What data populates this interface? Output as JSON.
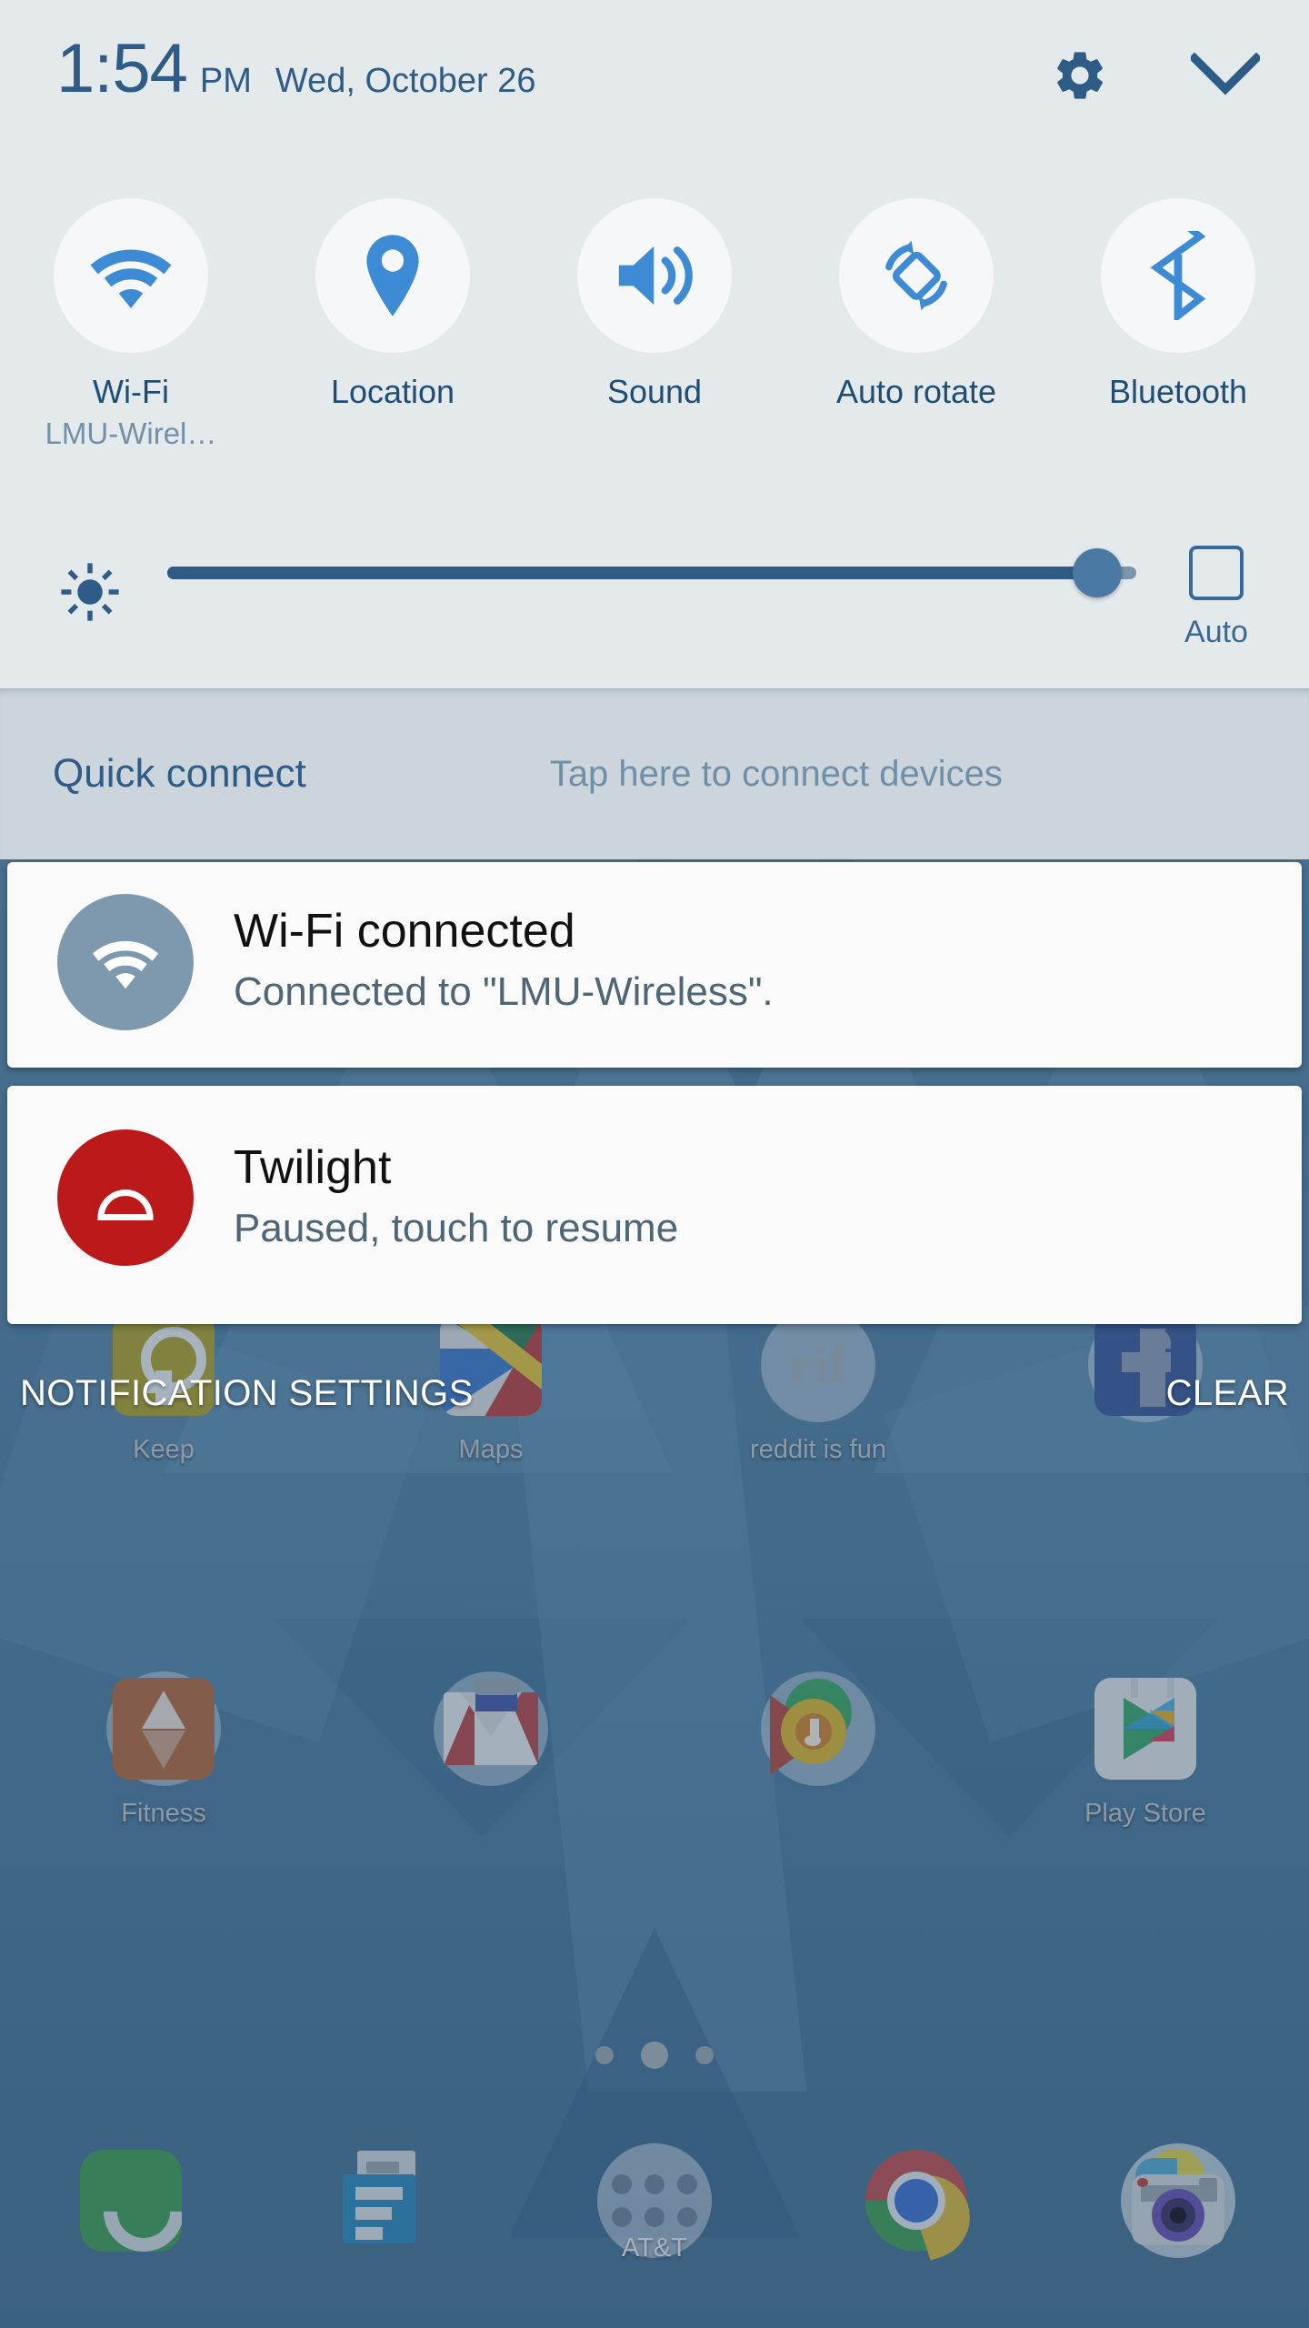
{
  "status_bar": {
    "time": "1:54",
    "am_pm": "PM",
    "date": "Wed, October 26",
    "settings_icon": "gear-icon",
    "collapse_icon": "chevron-down-icon"
  },
  "quick_toggles": [
    {
      "label": "Wi-Fi",
      "sub": "LMU-Wirel…",
      "icon": "wifi-icon",
      "active": true
    },
    {
      "label": "Location",
      "sub": "",
      "icon": "location-pin-icon",
      "active": true
    },
    {
      "label": "Sound",
      "sub": "",
      "icon": "sound-speaker-icon",
      "active": true
    },
    {
      "label": "Auto rotate",
      "sub": "",
      "icon": "auto-rotate-icon",
      "active": true
    },
    {
      "label": "Bluetooth",
      "sub": "",
      "icon": "bluetooth-icon",
      "active": true
    }
  ],
  "brightness": {
    "icon": "brightness-sun-icon",
    "value_percent": 96,
    "auto_label": "Auto",
    "auto_checked": false
  },
  "quick_connect": {
    "title": "Quick connect",
    "hint": "Tap here to connect devices"
  },
  "notifications": [
    {
      "title": "Wi-Fi connected",
      "body": "Connected to \"LMU-Wireless\".",
      "icon": "wifi-icon",
      "icon_color": "#7e99ad"
    },
    {
      "title": "Twilight",
      "body": "Paused, touch to resume",
      "icon": "twilight-dome-icon",
      "icon_color": "#bc1a1a"
    }
  ],
  "notification_actions": {
    "settings_label": "NOTIFICATION SETTINGS",
    "clear_label": "CLEAR"
  },
  "home_screen": {
    "app_rows": [
      [
        {
          "label": "Keep",
          "icon": "google-keep-icon"
        },
        {
          "label": "Maps",
          "icon": "google-maps-icon"
        },
        {
          "label": "reddit is fun",
          "icon": "rif-icon"
        },
        {
          "label": "",
          "icon": "facebook-icon"
        }
      ],
      [
        {
          "label": "Fitness",
          "icon": "fitness-icon"
        },
        {
          "label": "",
          "icon": "gmail-icon"
        },
        {
          "label": "",
          "icon": "play-music-icon"
        },
        {
          "label": "Play Store",
          "icon": "play-store-icon"
        }
      ]
    ],
    "page_dots": {
      "count": 3,
      "active_index": 1
    },
    "dock": [
      {
        "label": "",
        "icon": "phone-icon"
      },
      {
        "label": "",
        "icon": "messages-icon"
      },
      {
        "label": "AT&T",
        "icon": "app-drawer-icon"
      },
      {
        "label": "",
        "icon": "chrome-icon"
      },
      {
        "label": "",
        "icon": "camera-icon"
      }
    ]
  },
  "colors": {
    "panel_bg": "#e4e9ec",
    "quick_connect_bg": "#ccd5db",
    "accent_blue": "#3d8bd4",
    "text_navy": "#1f4d74",
    "card_bg": "#fafafa"
  }
}
